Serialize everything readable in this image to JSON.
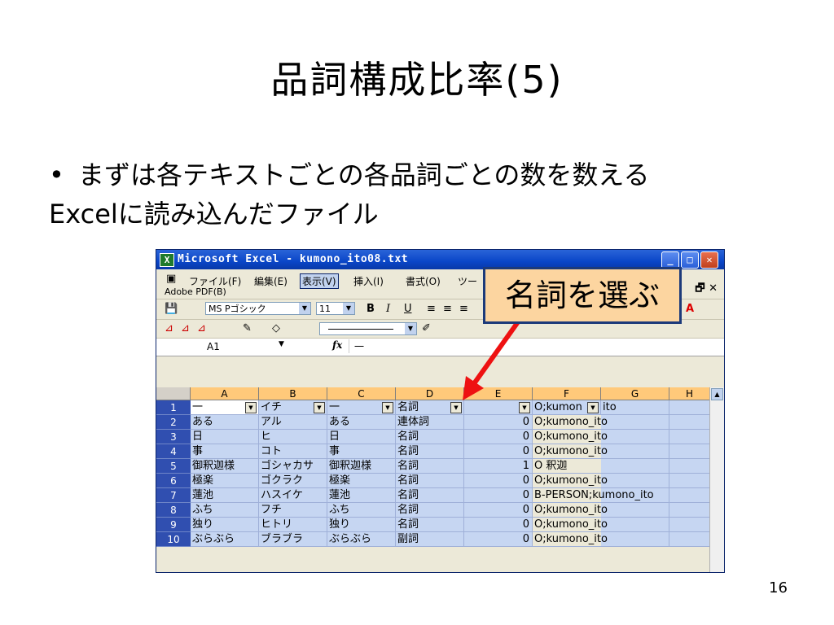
{
  "slide": {
    "title": "品詞構成比率(5)",
    "bullet_mark": "•",
    "bullet": "まずは各テキストごとの各品詞ごとの数を数える",
    "subline": "Excelに読み込んだファイル",
    "page_number": "16",
    "callout": "名詞を選ぶ"
  },
  "excel": {
    "window_title": "Microsoft Excel - kumono_ito08.txt",
    "menu": [
      "ファイル(F)",
      "編集(E)",
      "表示(V)",
      "挿入(I)",
      "書式(O)",
      "ツー"
    ],
    "active_menu": "表示(V)",
    "adobe_menu": "Adobe PDF(B)",
    "font_name": "MS Pゴシック",
    "font_size": "11",
    "name_box": "A1",
    "fx_label": "fx",
    "formula_value": "一",
    "columns": [
      "A",
      "B",
      "C",
      "D",
      "E",
      "F",
      "G",
      "H"
    ],
    "rows": [
      {
        "n": "1",
        "a": "一",
        "b": "イチ",
        "c": "一",
        "d": "名詞",
        "e": "",
        "f": "O;kumon",
        "g": "ito"
      },
      {
        "n": "2",
        "a": "ある",
        "b": "アル",
        "c": "ある",
        "d": "連体詞",
        "e": "0",
        "f": "O;kumono_ito",
        "g": ""
      },
      {
        "n": "3",
        "a": "日",
        "b": "ヒ",
        "c": "日",
        "d": "名詞",
        "e": "0",
        "f": "O;kumono_ito",
        "g": ""
      },
      {
        "n": "4",
        "a": "事",
        "b": "コト",
        "c": "事",
        "d": "名詞",
        "e": "0",
        "f": "O;kumono_ito",
        "g": ""
      },
      {
        "n": "5",
        "a": "御釈迦様",
        "b": "ゴシャカサ",
        "c": "御釈迦様",
        "d": "名詞",
        "e": "1",
        "f": "O 釈迦",
        "g": ""
      },
      {
        "n": "6",
        "a": "極楽",
        "b": "ゴクラク",
        "c": "極楽",
        "d": "名詞",
        "e": "0",
        "f": "O;kumono_ito",
        "g": ""
      },
      {
        "n": "7",
        "a": "蓮池",
        "b": "ハスイケ",
        "c": "蓮池",
        "d": "名詞",
        "e": "0",
        "f": "B-PERSON;kumono_ito",
        "g": ""
      },
      {
        "n": "8",
        "a": "ふち",
        "b": "フチ",
        "c": "ふち",
        "d": "名詞",
        "e": "0",
        "f": "O;kumono_ito",
        "g": ""
      },
      {
        "n": "9",
        "a": "独り",
        "b": "ヒトリ",
        "c": "独り",
        "d": "名詞",
        "e": "0",
        "f": "O;kumono_ito",
        "g": ""
      },
      {
        "n": "10",
        "a": "ぶらぶら",
        "b": "ブラブラ",
        "c": "ぶらぶら",
        "d": "副詞",
        "e": "0",
        "f": "O;kumono_ito",
        "g": ""
      }
    ]
  }
}
